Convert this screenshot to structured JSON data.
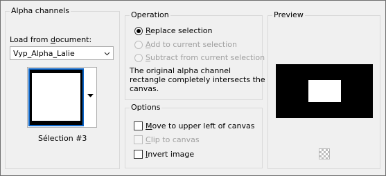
{
  "alpha_channels": {
    "title": "Alpha channels",
    "load_label_pre": "Load from ",
    "load_label_accel": "d",
    "load_label_post": "ocument:",
    "document_value": "Vyp_Alpha_Lalie",
    "selection_caption": "Sélection #3"
  },
  "operation": {
    "title": "Operation",
    "replace_accel": "R",
    "replace_rest": "eplace selection",
    "add_accel": "A",
    "add_rest": "dd to current selection",
    "subtract_accel": "S",
    "subtract_rest": "ubtract from current selection",
    "message_line1": "The original alpha channel",
    "message_line2": "rectangle completely intersects the",
    "message_line3": "canvas.",
    "selected": "replace"
  },
  "options": {
    "title": "Options",
    "move_accel": "M",
    "move_rest": "ove to upper left of canvas",
    "clip_accel": "C",
    "clip_rest": "lip to canvas",
    "invert_accel": "I",
    "invert_rest": "nvert image",
    "move_checked": false,
    "clip_checked": false,
    "invert_checked": false
  },
  "preview": {
    "title": "Preview"
  },
  "colors": {
    "thumb_border": "#0a64c8",
    "background": "#f0f0f0"
  }
}
